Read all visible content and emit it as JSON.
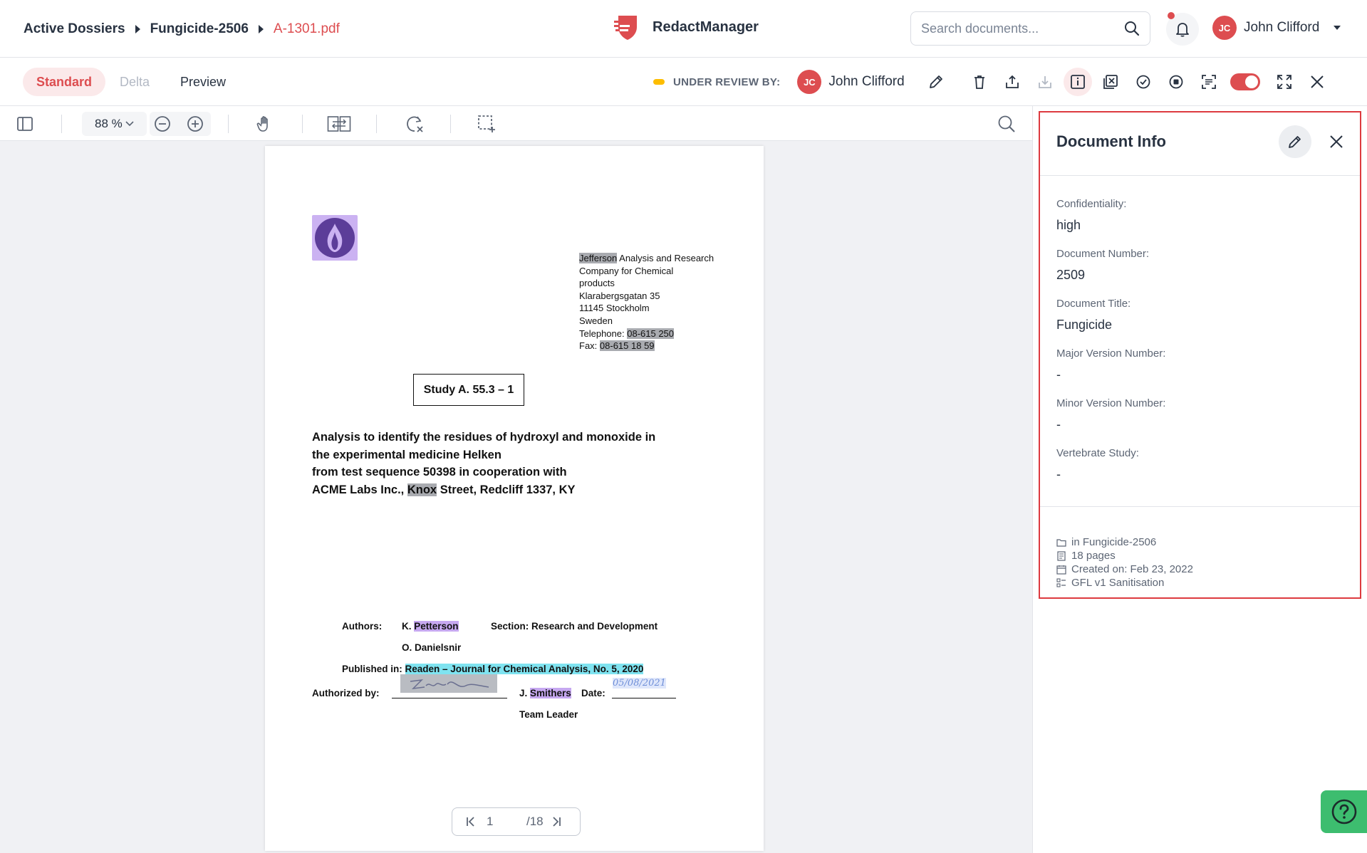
{
  "breadcrumb": {
    "items": [
      "Active Dossiers",
      "Fungicide-2506"
    ],
    "current": "A-1301.pdf"
  },
  "brand": {
    "name": "RedactManager",
    "color": "#dd4d50"
  },
  "search": {
    "placeholder": "Search documents..."
  },
  "user": {
    "initials": "JC",
    "name": "John Clifford"
  },
  "view_tabs": [
    {
      "label": "Standard",
      "state": "active"
    },
    {
      "label": "Delta",
      "state": "disabled"
    },
    {
      "label": "Preview",
      "state": "normal"
    }
  ],
  "review": {
    "status_label": "UNDER REVIEW BY:",
    "status_color": "#fdbd00",
    "reviewer_initials": "JC",
    "reviewer_name": "John Clifford"
  },
  "action_icons": [
    "delete-icon",
    "upload-icon",
    "download-icon",
    "info-icon",
    "excluded-pages-icon",
    "approve-icon",
    "stop-icon",
    "ocr-icon",
    "toggle-switch",
    "fullscreen-icon",
    "close-icon"
  ],
  "pdf_toolbar": {
    "zoom": "88 %",
    "tools": [
      "sidebar-toggle-icon",
      "zoom-out-icon",
      "zoom-in-icon",
      "pan-hand-icon",
      "compare-icon",
      "rotate-clear-icon",
      "area-select-icon",
      "search-icon"
    ]
  },
  "document": {
    "address_lines": [
      {
        "parts": [
          {
            "text": "Jefferson",
            "redacted": true
          },
          {
            "text": " Analysis and Research"
          }
        ]
      },
      {
        "parts": [
          {
            "text": "Company for Chemical"
          }
        ]
      },
      {
        "parts": [
          {
            "text": "products"
          }
        ]
      },
      {
        "parts": [
          {
            "text": "Klarabergsgatan 35"
          }
        ]
      },
      {
        "parts": [
          {
            "text": "11145 Stockholm"
          }
        ]
      },
      {
        "parts": [
          {
            "text": "Sweden"
          }
        ]
      },
      {
        "parts": [
          {
            "text": "Telephone: "
          },
          {
            "text": "08-615 250",
            "redacted": true
          }
        ]
      },
      {
        "parts": [
          {
            "text": "Fax: "
          },
          {
            "text": "08-615 18 59",
            "redacted": true
          }
        ]
      }
    ],
    "study": "Study A. 55.3 – 1",
    "title_lines": [
      "Analysis to identify the residues of hydroxyl and monoxide in",
      "the experimental medicine Helken",
      "from test sequence 50398 in cooperation with"
    ],
    "title_last": {
      "before": "ACME Labs Inc., ",
      "redacted": "Knox",
      "after": " Street, Redcliff 1337, KY"
    },
    "authors_label": "Authors:",
    "author1_prefix": "K. ",
    "author1_name": "Petterson",
    "author2": "O. Danielsnir",
    "section": "Section: Research and Development",
    "published_label": "Published in: ",
    "published_value": "Readen – Journal for Chemical Analysis, No. 5, 2020",
    "authorized_label": "Authorized by:",
    "signer_prefix": "J. ",
    "signer_name": "Smithers",
    "date_label": "Date:",
    "date_value": "05/08/2021",
    "team_leader": "Team Leader"
  },
  "pager": {
    "current": "1",
    "total": "/18"
  },
  "document_info": {
    "title": "Document Info",
    "fields": [
      {
        "label": "Confidentiality:",
        "value": "high"
      },
      {
        "label": "Document Number:",
        "value": "2509"
      },
      {
        "label": "Document Title:",
        "value": "Fungicide"
      },
      {
        "label": "Major Version Number:",
        "value": "-"
      },
      {
        "label": "Minor Version Number:",
        "value": "-"
      },
      {
        "label": "Vertebrate Study:",
        "value": "-"
      }
    ],
    "meta": [
      {
        "icon": "folder-icon",
        "text": "in Fungicide-2506"
      },
      {
        "icon": "pages-icon",
        "text": "18 pages"
      },
      {
        "icon": "calendar-icon",
        "text": "Created on: Feb 23, 2022"
      },
      {
        "icon": "template-icon",
        "text": "GFL v1 Sanitisation"
      }
    ]
  },
  "help": {
    "icon": "help-icon",
    "color": "#3dbd6f"
  }
}
